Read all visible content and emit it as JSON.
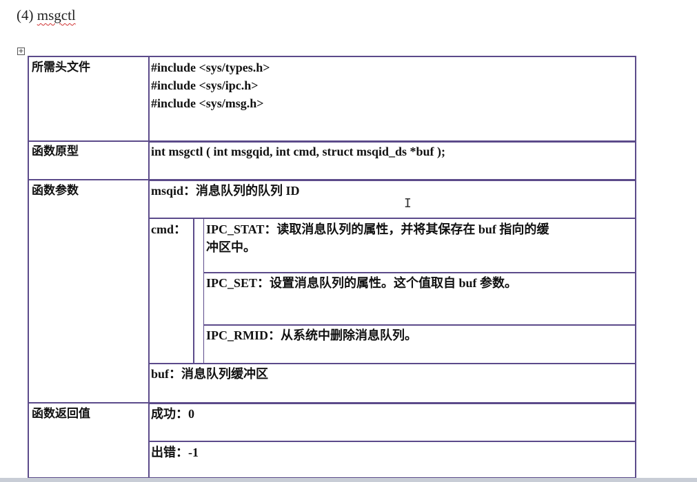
{
  "heading": {
    "number": "(4)",
    "function_name": "msgctl"
  },
  "table": {
    "rows": {
      "headers": {
        "label": "所需头文件",
        "lines": [
          "#include <sys/types.h>",
          "#include <sys/ipc.h>",
          "#include <sys/msg.h>"
        ]
      },
      "prototype": {
        "label": "函数原型",
        "text": "int msgctl ( int msgqid, int cmd, struct msqid_ds *buf );"
      },
      "params": {
        "label": "函数参数",
        "msqid": "msqid：消息队列的队列 ID",
        "cmd_label": "cmd：",
        "cmd_options": [
          {
            "line1": "IPC_STAT：读取消息队列的属性，并将其保存在 buf 指向的缓",
            "line2": "冲区中。"
          },
          {
            "line1": "IPC_SET：设置消息队列的属性。这个值取自 buf 参数。"
          },
          {
            "line1": "IPC_RMID：从系统中删除消息队列。"
          }
        ],
        "buf": "buf：消息队列缓冲区"
      },
      "return": {
        "label": "函数返回值",
        "success": "成功：0",
        "error": "出错：-1"
      }
    }
  },
  "colors": {
    "border": "#5b4a8a",
    "spellcheck": "#d03030"
  }
}
